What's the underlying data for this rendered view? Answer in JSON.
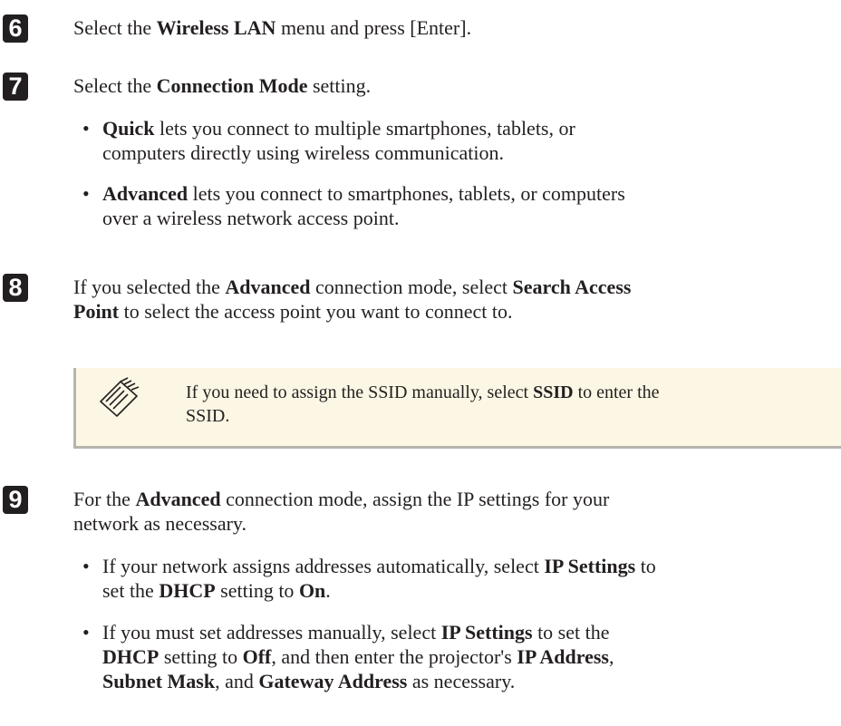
{
  "steps": [
    {
      "number": "6",
      "lines": [
        [
          {
            "t": "Select the "
          },
          {
            "t": "Wireless LAN",
            "b": true
          },
          {
            "t": " menu and press [Enter]."
          }
        ]
      ]
    },
    {
      "number": "7",
      "lines": [
        [
          {
            "t": "Select the "
          },
          {
            "t": "Connection Mode",
            "b": true
          },
          {
            "t": " setting."
          }
        ]
      ],
      "bullets": [
        {
          "lines": [
            [
              {
                "t": "Quick",
                "b": true
              },
              {
                "t": " lets you connect to multiple smartphones, tablets, or"
              }
            ],
            [
              {
                "t": "computers directly using wireless communication."
              }
            ]
          ]
        },
        {
          "lines": [
            [
              {
                "t": "Advanced",
                "b": true
              },
              {
                "t": " lets you connect to smartphones, tablets, or computers"
              }
            ],
            [
              {
                "t": "over a wireless network access point."
              }
            ]
          ]
        }
      ]
    },
    {
      "number": "8",
      "lines": [
        [
          {
            "t": "If you selected the "
          },
          {
            "t": "Advanced",
            "b": true
          },
          {
            "t": " connection mode, select "
          },
          {
            "t": "Search Access",
            "b": true
          }
        ],
        [
          {
            "t": "Point",
            "b": true
          },
          {
            "t": " to select the access point you want to connect to."
          }
        ]
      ],
      "note": {
        "icon": "note-pencil-icon",
        "lines": [
          [
            {
              "t": "If you need to assign the SSID manually, select "
            },
            {
              "t": "SSID",
              "b": true
            },
            {
              "t": " to enter the"
            }
          ],
          [
            {
              "t": "SSID."
            }
          ]
        ]
      }
    },
    {
      "number": "9",
      "lines": [
        [
          {
            "t": "For the "
          },
          {
            "t": "Advanced",
            "b": true
          },
          {
            "t": " connection mode, assign the IP settings for your"
          }
        ],
        [
          {
            "t": "network as necessary."
          }
        ]
      ],
      "bullets": [
        {
          "lines": [
            [
              {
                "t": "If your network assigns addresses automatically, select "
              },
              {
                "t": "IP Settings",
                "b": true
              },
              {
                "t": " to"
              }
            ],
            [
              {
                "t": "set the "
              },
              {
                "t": "DHCP",
                "b": true
              },
              {
                "t": " setting to "
              },
              {
                "t": "On",
                "b": true
              },
              {
                "t": "."
              }
            ]
          ]
        },
        {
          "lines": [
            [
              {
                "t": "If you must set addresses manually, select "
              },
              {
                "t": "IP Settings",
                "b": true
              },
              {
                "t": " to set the"
              }
            ],
            [
              {
                "t": "DHCP",
                "b": true
              },
              {
                "t": " setting to "
              },
              {
                "t": "Off",
                "b": true
              },
              {
                "t": ", and then enter the projector's "
              },
              {
                "t": "IP Address",
                "b": true
              },
              {
                "t": ","
              }
            ],
            [
              {
                "t": "Subnet Mask",
                "b": true
              },
              {
                "t": ", and "
              },
              {
                "t": "Gateway Address",
                "b": true
              },
              {
                "t": " as necessary."
              }
            ]
          ]
        }
      ]
    }
  ],
  "colors": {
    "text": "#231f20",
    "note_bg": "#fcf6e4",
    "note_border": "#b7b4ae"
  }
}
